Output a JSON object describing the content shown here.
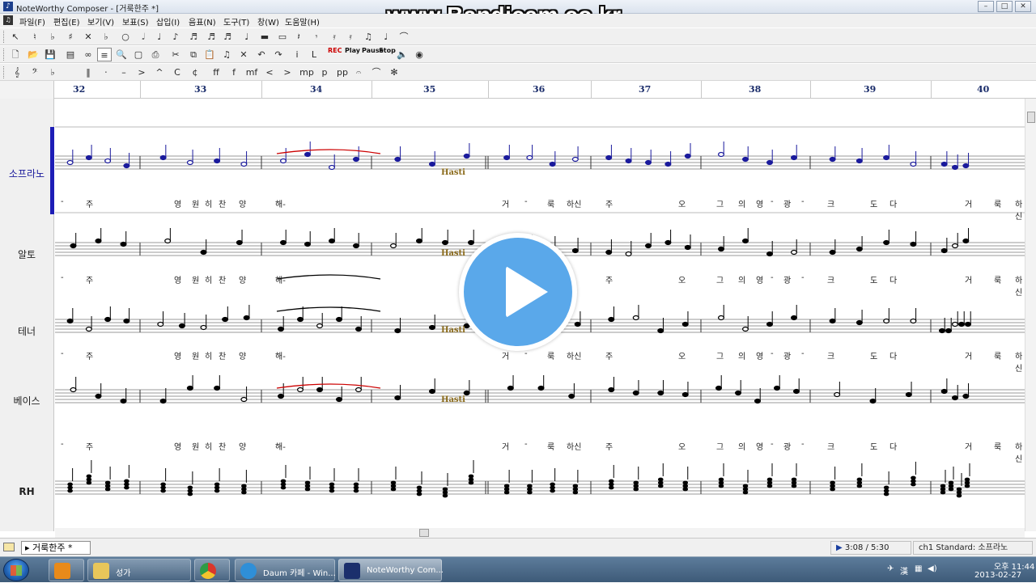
{
  "window": {
    "title": "NoteWorthy Composer - [거룩한주 *]"
  },
  "watermark": "www.Bandicam.co.kr",
  "menu": [
    {
      "label": "파일(F)"
    },
    {
      "label": "편집(E)"
    },
    {
      "label": "보기(V)"
    },
    {
      "label": "보표(S)"
    },
    {
      "label": "삽입(I)"
    },
    {
      "label": "음표(N)"
    },
    {
      "label": "도구(T)"
    },
    {
      "label": "창(W)"
    },
    {
      "label": "도움말(H)"
    }
  ],
  "toolbar_media": {
    "play": "Play",
    "pause": "Pause",
    "stop": "Stop",
    "rec": "REC"
  },
  "ruler": {
    "bars": [
      "32",
      "33",
      "34",
      "35",
      "36",
      "37",
      "38",
      "39",
      "40"
    ]
  },
  "staves": [
    {
      "name": "소프라노",
      "active": true,
      "lyrics": [
        "-",
        "주",
        "영",
        "원",
        "히",
        "찬",
        "양",
        "해-",
        "거",
        "-",
        "룩",
        "하신",
        "주",
        "오",
        "그",
        "의",
        "영",
        "-",
        "광",
        "-",
        "크",
        "도",
        "다",
        "거",
        "룩",
        "하신"
      ]
    },
    {
      "name": "알토",
      "active": false,
      "lyrics": [
        "-",
        "주",
        "영",
        "원",
        "히",
        "찬",
        "양",
        "해-",
        "주",
        "오",
        "그",
        "의",
        "영",
        "-",
        "광",
        "-",
        "크",
        "도",
        "다",
        "거",
        "룩",
        "하신"
      ]
    },
    {
      "name": "테너",
      "active": false,
      "lyrics": [
        "-",
        "주",
        "영",
        "원",
        "히",
        "찬",
        "양",
        "해-",
        "거",
        "-",
        "룩",
        "하신",
        "주",
        "오",
        "그",
        "의",
        "영",
        "-",
        "광",
        "-",
        "크",
        "도",
        "다",
        "거",
        "룩",
        "하신"
      ]
    },
    {
      "name": "베이스",
      "active": false,
      "lyrics": [
        "-",
        "주",
        "영",
        "원",
        "히",
        "찬",
        "양",
        "해-",
        "거",
        "-",
        "룩",
        "하신",
        "주",
        "오",
        "그",
        "의",
        "영",
        "-",
        "광",
        "-",
        "크",
        "도",
        "다",
        "거",
        "룩",
        "하신"
      ]
    },
    {
      "name": "RH",
      "active": false,
      "lyrics": []
    }
  ],
  "tempo_marking": "Hasti",
  "status": {
    "doc_tab": "거룩한주 *",
    "time": "3:08 / 5:30",
    "channel": "ch1 Standard: 소프라노"
  },
  "taskbar": {
    "items": [
      {
        "label": ""
      },
      {
        "label": "성가"
      },
      {
        "label": ""
      },
      {
        "label": "Daum 카페 - Win..."
      },
      {
        "label": "NoteWorthy Com..."
      }
    ],
    "tray_lang": "漢",
    "clock_time": "오후 11:44",
    "clock_date": "2013-02-27"
  }
}
